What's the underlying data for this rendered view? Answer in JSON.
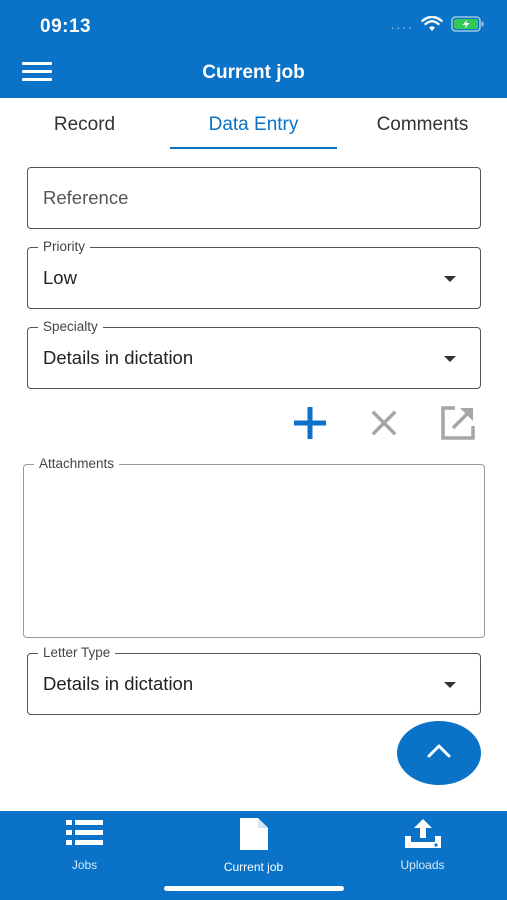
{
  "status_bar": {
    "time": "09:13",
    "signal": "····",
    "battery_color": "#34c759"
  },
  "header": {
    "title": "Current job",
    "menu_icon": "hamburger-menu-icon"
  },
  "tabs": [
    {
      "label": "Record",
      "active": false
    },
    {
      "label": "Data Entry",
      "active": true
    },
    {
      "label": "Comments",
      "active": false
    }
  ],
  "form": {
    "reference": {
      "placeholder": "Reference",
      "value": ""
    },
    "priority": {
      "label": "Priority",
      "value": "Low"
    },
    "specialty": {
      "label": "Specialty",
      "value": "Details in dictation"
    },
    "attachments": {
      "label": "Attachments"
    },
    "letter_type": {
      "label": "Letter Type",
      "value": "Details in dictation"
    }
  },
  "attachment_actions": [
    {
      "icon": "add-icon",
      "enabled": true
    },
    {
      "icon": "close-icon",
      "enabled": false
    },
    {
      "icon": "open-external-icon",
      "enabled": false
    }
  ],
  "fab": {
    "icon": "chevron-up-icon"
  },
  "bottom_nav": [
    {
      "label": "Jobs",
      "icon": "list-icon",
      "active": false
    },
    {
      "label": "Current job",
      "icon": "document-icon",
      "active": true
    },
    {
      "label": "Uploads",
      "icon": "upload-icon",
      "active": false
    }
  ],
  "colors": {
    "primary": "#0a72c7",
    "disabled_icon": "#a6a6a6"
  }
}
